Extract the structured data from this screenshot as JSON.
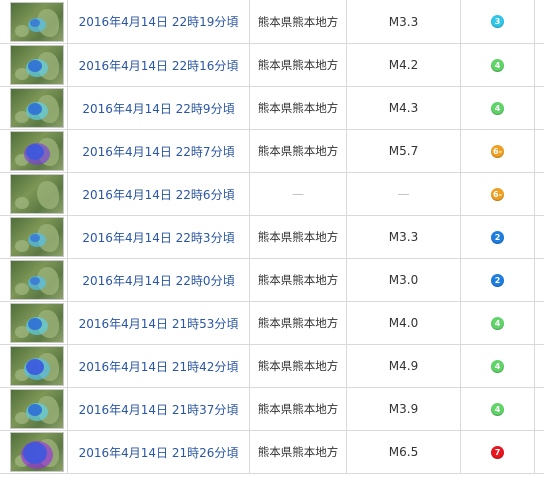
{
  "rows": [
    {
      "time": "2016年4月14日 22時19分頃",
      "area": "熊本県熊本地方",
      "mag": "M3.3",
      "intensity": "3",
      "icon": "intensity-3-icon",
      "color": "#2fc6e8",
      "map": {
        "level": 1,
        "c1": "#3a7bd5",
        "c2": "#4fc3f7"
      }
    },
    {
      "time": "2016年4月14日 22時16分頃",
      "area": "熊本県熊本地方",
      "mag": "M4.2",
      "intensity": "4",
      "icon": "intensity-4-icon",
      "color": "#5fd468",
      "map": {
        "level": 2,
        "c1": "#2f6fd6",
        "c2": "#5ad3f0"
      }
    },
    {
      "time": "2016年4月14日 22時9分頃",
      "area": "熊本県熊本地方",
      "mag": "M4.3",
      "intensity": "4",
      "icon": "intensity-4-icon",
      "color": "#5fd468",
      "map": {
        "level": 2,
        "c1": "#2f6fd6",
        "c2": "#5ad3f0"
      }
    },
    {
      "time": "2016年4月14日 22時7分頃",
      "area": "熊本県熊本地方",
      "mag": "M5.7",
      "intensity": "6-",
      "icon": "intensity-6-minus-icon",
      "color": "#f0a020",
      "map": {
        "level": 3,
        "c1": "#3c58e0",
        "c2": "#7b3fe0"
      }
    },
    {
      "time": "2016年4月14日 22時6分頃",
      "area": "—",
      "mag": "—",
      "intensity": "6-",
      "icon": "intensity-6-minus-icon",
      "color": "#f0a020",
      "map": {
        "level": 0,
        "c1": "#6e8a4e",
        "c2": "#6e8a4e"
      }
    },
    {
      "time": "2016年4月14日 22時3分頃",
      "area": "熊本県熊本地方",
      "mag": "M3.3",
      "intensity": "2",
      "icon": "intensity-2-icon",
      "color": "#1e7de0",
      "map": {
        "level": 1,
        "c1": "#3a7bd5",
        "c2": "#4fc3f7"
      }
    },
    {
      "time": "2016年4月14日 22時0分頃",
      "area": "熊本県熊本地方",
      "mag": "M3.0",
      "intensity": "2",
      "icon": "intensity-2-icon",
      "color": "#1e7de0",
      "map": {
        "level": 1,
        "c1": "#3a7bd5",
        "c2": "#4fc3f7"
      }
    },
    {
      "time": "2016年4月14日 21時53分頃",
      "area": "熊本県熊本地方",
      "mag": "M4.0",
      "intensity": "4",
      "icon": "intensity-4-icon",
      "color": "#5fd468",
      "map": {
        "level": 2,
        "c1": "#2f6fd6",
        "c2": "#5ad3f0"
      }
    },
    {
      "time": "2016年4月14日 21時42分頃",
      "area": "熊本県熊本地方",
      "mag": "M4.9",
      "intensity": "4",
      "icon": "intensity-4-icon",
      "color": "#5fd468",
      "map": {
        "level": 3,
        "c1": "#3c58e0",
        "c2": "#4fc3f7"
      }
    },
    {
      "time": "2016年4月14日 21時37分頃",
      "area": "熊本県熊本地方",
      "mag": "M3.9",
      "intensity": "4",
      "icon": "intensity-4-icon",
      "color": "#5fd468",
      "map": {
        "level": 2,
        "c1": "#2f6fd6",
        "c2": "#5ad3f0"
      }
    },
    {
      "time": "2016年4月14日 21時26分頃",
      "area": "熊本県熊本地方",
      "mag": "M6.5",
      "intensity": "7",
      "icon": "intensity-7-icon",
      "color": "#e8141e",
      "map": {
        "level": 4,
        "c1": "#3c58e0",
        "c2": "#9b2fe0"
      }
    }
  ]
}
